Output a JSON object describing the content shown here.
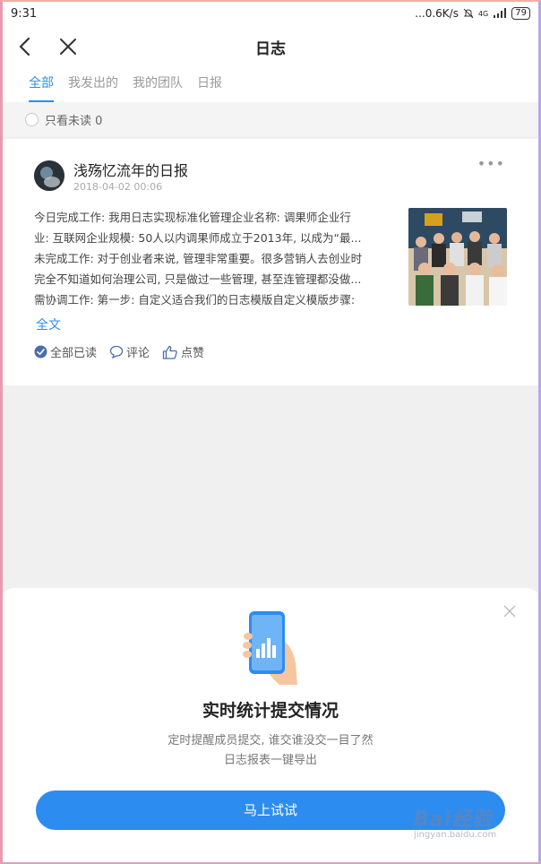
{
  "statusbar": {
    "time": "9:31",
    "speed": "...0.6K/s",
    "network": "4G",
    "battery": "79"
  },
  "header": {
    "title": "日志"
  },
  "tabs": [
    {
      "label": "全部",
      "active": true
    },
    {
      "label": "我发出的",
      "active": false
    },
    {
      "label": "我的团队",
      "active": false
    },
    {
      "label": "日报",
      "active": false
    }
  ],
  "filter": {
    "label": "只看未读 0"
  },
  "post": {
    "author": "浅殇忆流年的日报",
    "date": "2018-04-02 00:06",
    "lines": [
      "今日完成工作: 我用日志实现标准化管理企业名称: 调果师企业行",
      "业: 互联网企业规模: 50人以内调果师成立于2013年, 以成为“最...",
      "未完成工作: 对于创业者来说, 管理非常重要。很多营销人去创业时",
      "完全不知道如何治理公司, 只是做过一些管理, 甚至连管理都没做...",
      "需协调工作: 第一步: 自定义适合我们的日志模版自定义模版步骤:"
    ],
    "fulltext_link": "全文",
    "actions": {
      "read_all": "全部已读",
      "comment": "评论",
      "like": "点赞"
    }
  },
  "promo": {
    "title": "实时统计提交情况",
    "subtitle_line1": "定时提醒成员提交, 谁交谁没交一目了然",
    "subtitle_line2": "日志报表一键导出",
    "cta": "马上试试"
  },
  "watermark": {
    "brand": "Bai经验",
    "url": "jingyan.baidu.com"
  },
  "colors": {
    "accent": "#2d8cf0"
  }
}
